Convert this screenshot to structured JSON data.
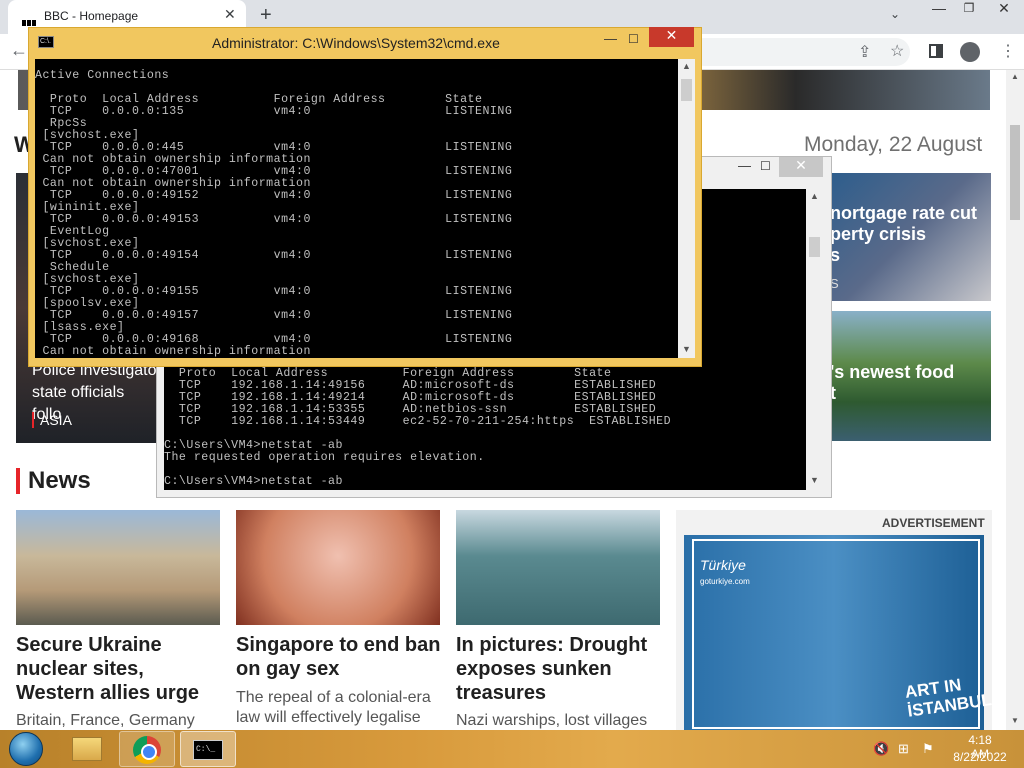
{
  "browser": {
    "tab_title": "BBC - Homepage",
    "tab_close": "✕",
    "new_tab": "+",
    "tab_menu": "⌄",
    "win_min": "—",
    "win_max": "❐",
    "win_close": "✕",
    "back": "←",
    "share_icon": "⇪",
    "star_icon": "☆",
    "menu_icon": "⋮"
  },
  "page": {
    "welcome_partial": "W",
    "date": "Monday, 22 August",
    "left_story": {
      "text": "Police investigato... state officials follo...",
      "line1": "Police investigato",
      "line2": "state officials follo",
      "tag": "ASIA"
    },
    "mortgage_story": {
      "line1": "nortgage rate cut",
      "line2": "perty crisis",
      "line3": "s",
      "sub": "S"
    },
    "food_story": {
      "line1": "'s newest food",
      "line2": "t"
    },
    "news_heading": "News",
    "cards": [
      {
        "title": "Secure Ukraine nuclear sites, Western allies urge",
        "desc": "Britain, France, Germany"
      },
      {
        "title": "Singapore to end ban on gay sex",
        "desc": "The repeal of a colonial-era law will effectively legalise"
      },
      {
        "title": "In pictures: Drought exposes sunken treasures",
        "desc": "Nazi warships, lost villages"
      }
    ],
    "ad": {
      "label": "ADVERTISEMENT",
      "brand": "Türkiye",
      "url": "goturkiye.com",
      "art_text": "ART IN İSTANBUL"
    },
    "scroll_up": "▲",
    "scroll_down": "▼"
  },
  "cmd_admin": {
    "icon_text": "C:\\.",
    "title": "Administrator: C:\\Windows\\System32\\cmd.exe",
    "min": "—",
    "max": "☐",
    "close": "✕",
    "lines": [
      "Active Connections",
      "",
      "  Proto  Local Address          Foreign Address        State",
      "  TCP    0.0.0.0:135            vm4:0                  LISTENING",
      "  RpcSs",
      " [svchost.exe]",
      "  TCP    0.0.0.0:445            vm4:0                  LISTENING",
      " Can not obtain ownership information",
      "  TCP    0.0.0.0:47001          vm4:0                  LISTENING",
      " Can not obtain ownership information",
      "  TCP    0.0.0.0:49152          vm4:0                  LISTENING",
      " [wininit.exe]",
      "  TCP    0.0.0.0:49153          vm4:0                  LISTENING",
      "  EventLog",
      " [svchost.exe]",
      "  TCP    0.0.0.0:49154          vm4:0                  LISTENING",
      "  Schedule",
      " [svchost.exe]",
      "  TCP    0.0.0.0:49155          vm4:0                  LISTENING",
      " [spoolsv.exe]",
      "  TCP    0.0.0.0:49157          vm4:0                  LISTENING",
      " [lsass.exe]",
      "  TCP    0.0.0.0:49168          vm4:0                  LISTENING",
      " Can not obtain ownership information"
    ],
    "scroll_up": "▲",
    "scroll_down": "▼"
  },
  "cmd_user": {
    "min": "—",
    "max": "☐",
    "close": "✕",
    "lines": [
      "  Proto  Local Address          Foreign Address        State",
      "  TCP    192.168.1.14:49156     AD:microsoft-ds        ESTABLISHED",
      "  TCP    192.168.1.14:49214     AD:microsoft-ds        ESTABLISHED",
      "  TCP    192.168.1.14:53355     AD:netbios-ssn         ESTABLISHED",
      "  TCP    192.168.1.14:53449     ec2-52-70-211-254:https  ESTABLISHED",
      "",
      "C:\\Users\\VM4>netstat -ab",
      "The requested operation requires elevation.",
      "",
      "C:\\Users\\VM4>netstat -ab"
    ],
    "scroll_up": "▲",
    "scroll_down": "▼"
  },
  "taskbar": {
    "cmd_icon_text": "C:\\_",
    "vol_icon": "🔇",
    "net_icon": "⊞",
    "flag_icon": "⚑",
    "time": "4:18 AM",
    "date": "8/22/2022"
  }
}
